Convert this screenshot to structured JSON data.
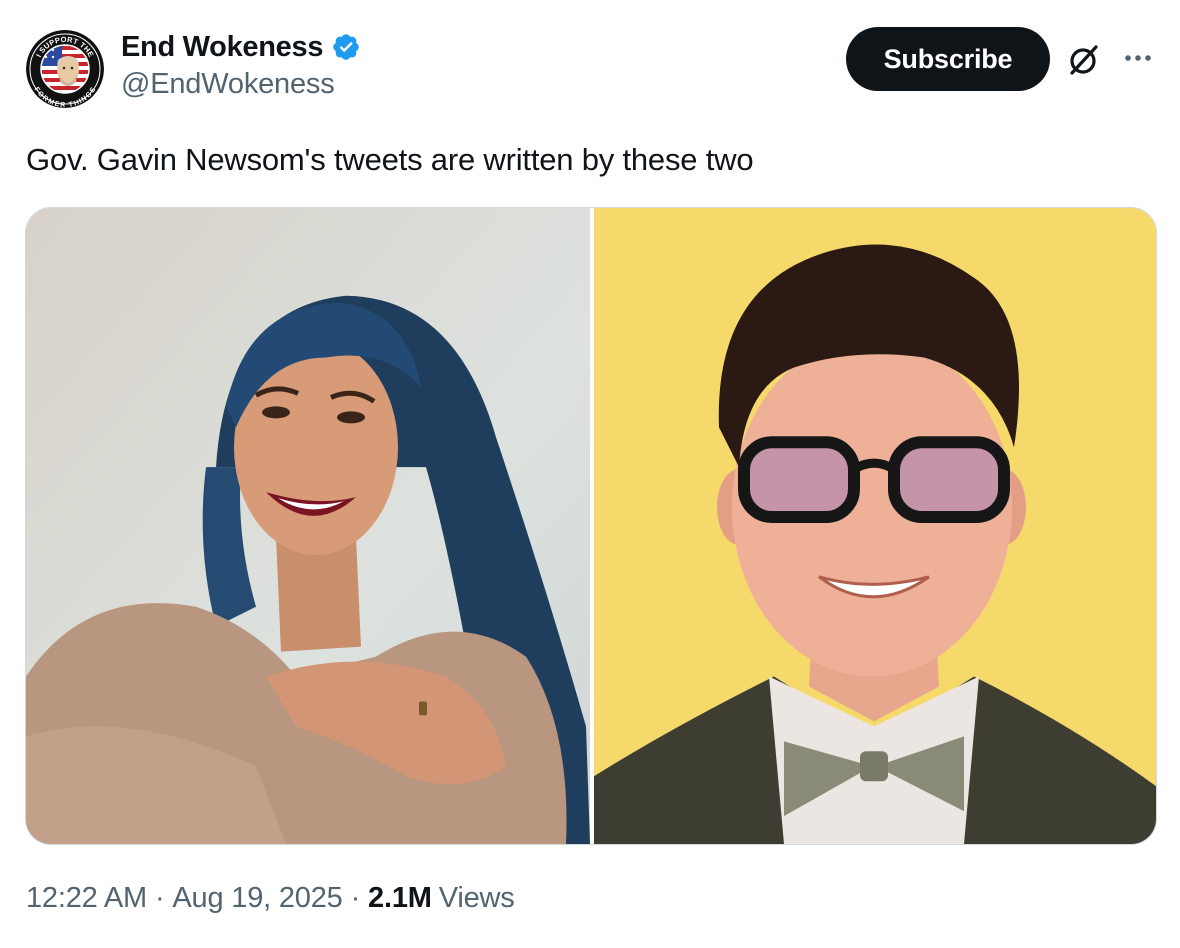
{
  "author": {
    "display_name": "End Wokeness",
    "handle": "@EndWokeness",
    "verified": true,
    "avatar_top_text": "I SUPPORT THE",
    "avatar_bottom_text": "FORMER THINGS"
  },
  "actions": {
    "subscribe_label": "Subscribe",
    "grok_icon": "slashed-circle-icon",
    "more_icon": "ellipsis-icon"
  },
  "post": {
    "text": "Gov. Gavin Newsom's tweets are written by these two"
  },
  "media": {
    "photos": [
      {
        "subject": "woman-with-blue-hair",
        "background": "#d9dcd9"
      },
      {
        "subject": "man-with-glasses-bowtie",
        "background": "#f6d96b"
      }
    ]
  },
  "meta": {
    "time": "12:22 AM",
    "separator": "·",
    "date": "Aug 19, 2025",
    "views_count": "2.1M",
    "views_label": "Views"
  },
  "colors": {
    "text_primary": "#0f1419",
    "text_secondary": "#536471",
    "verified_blue": "#1d9bf0",
    "button_bg": "#0f1419",
    "border": "#cfd9de"
  }
}
